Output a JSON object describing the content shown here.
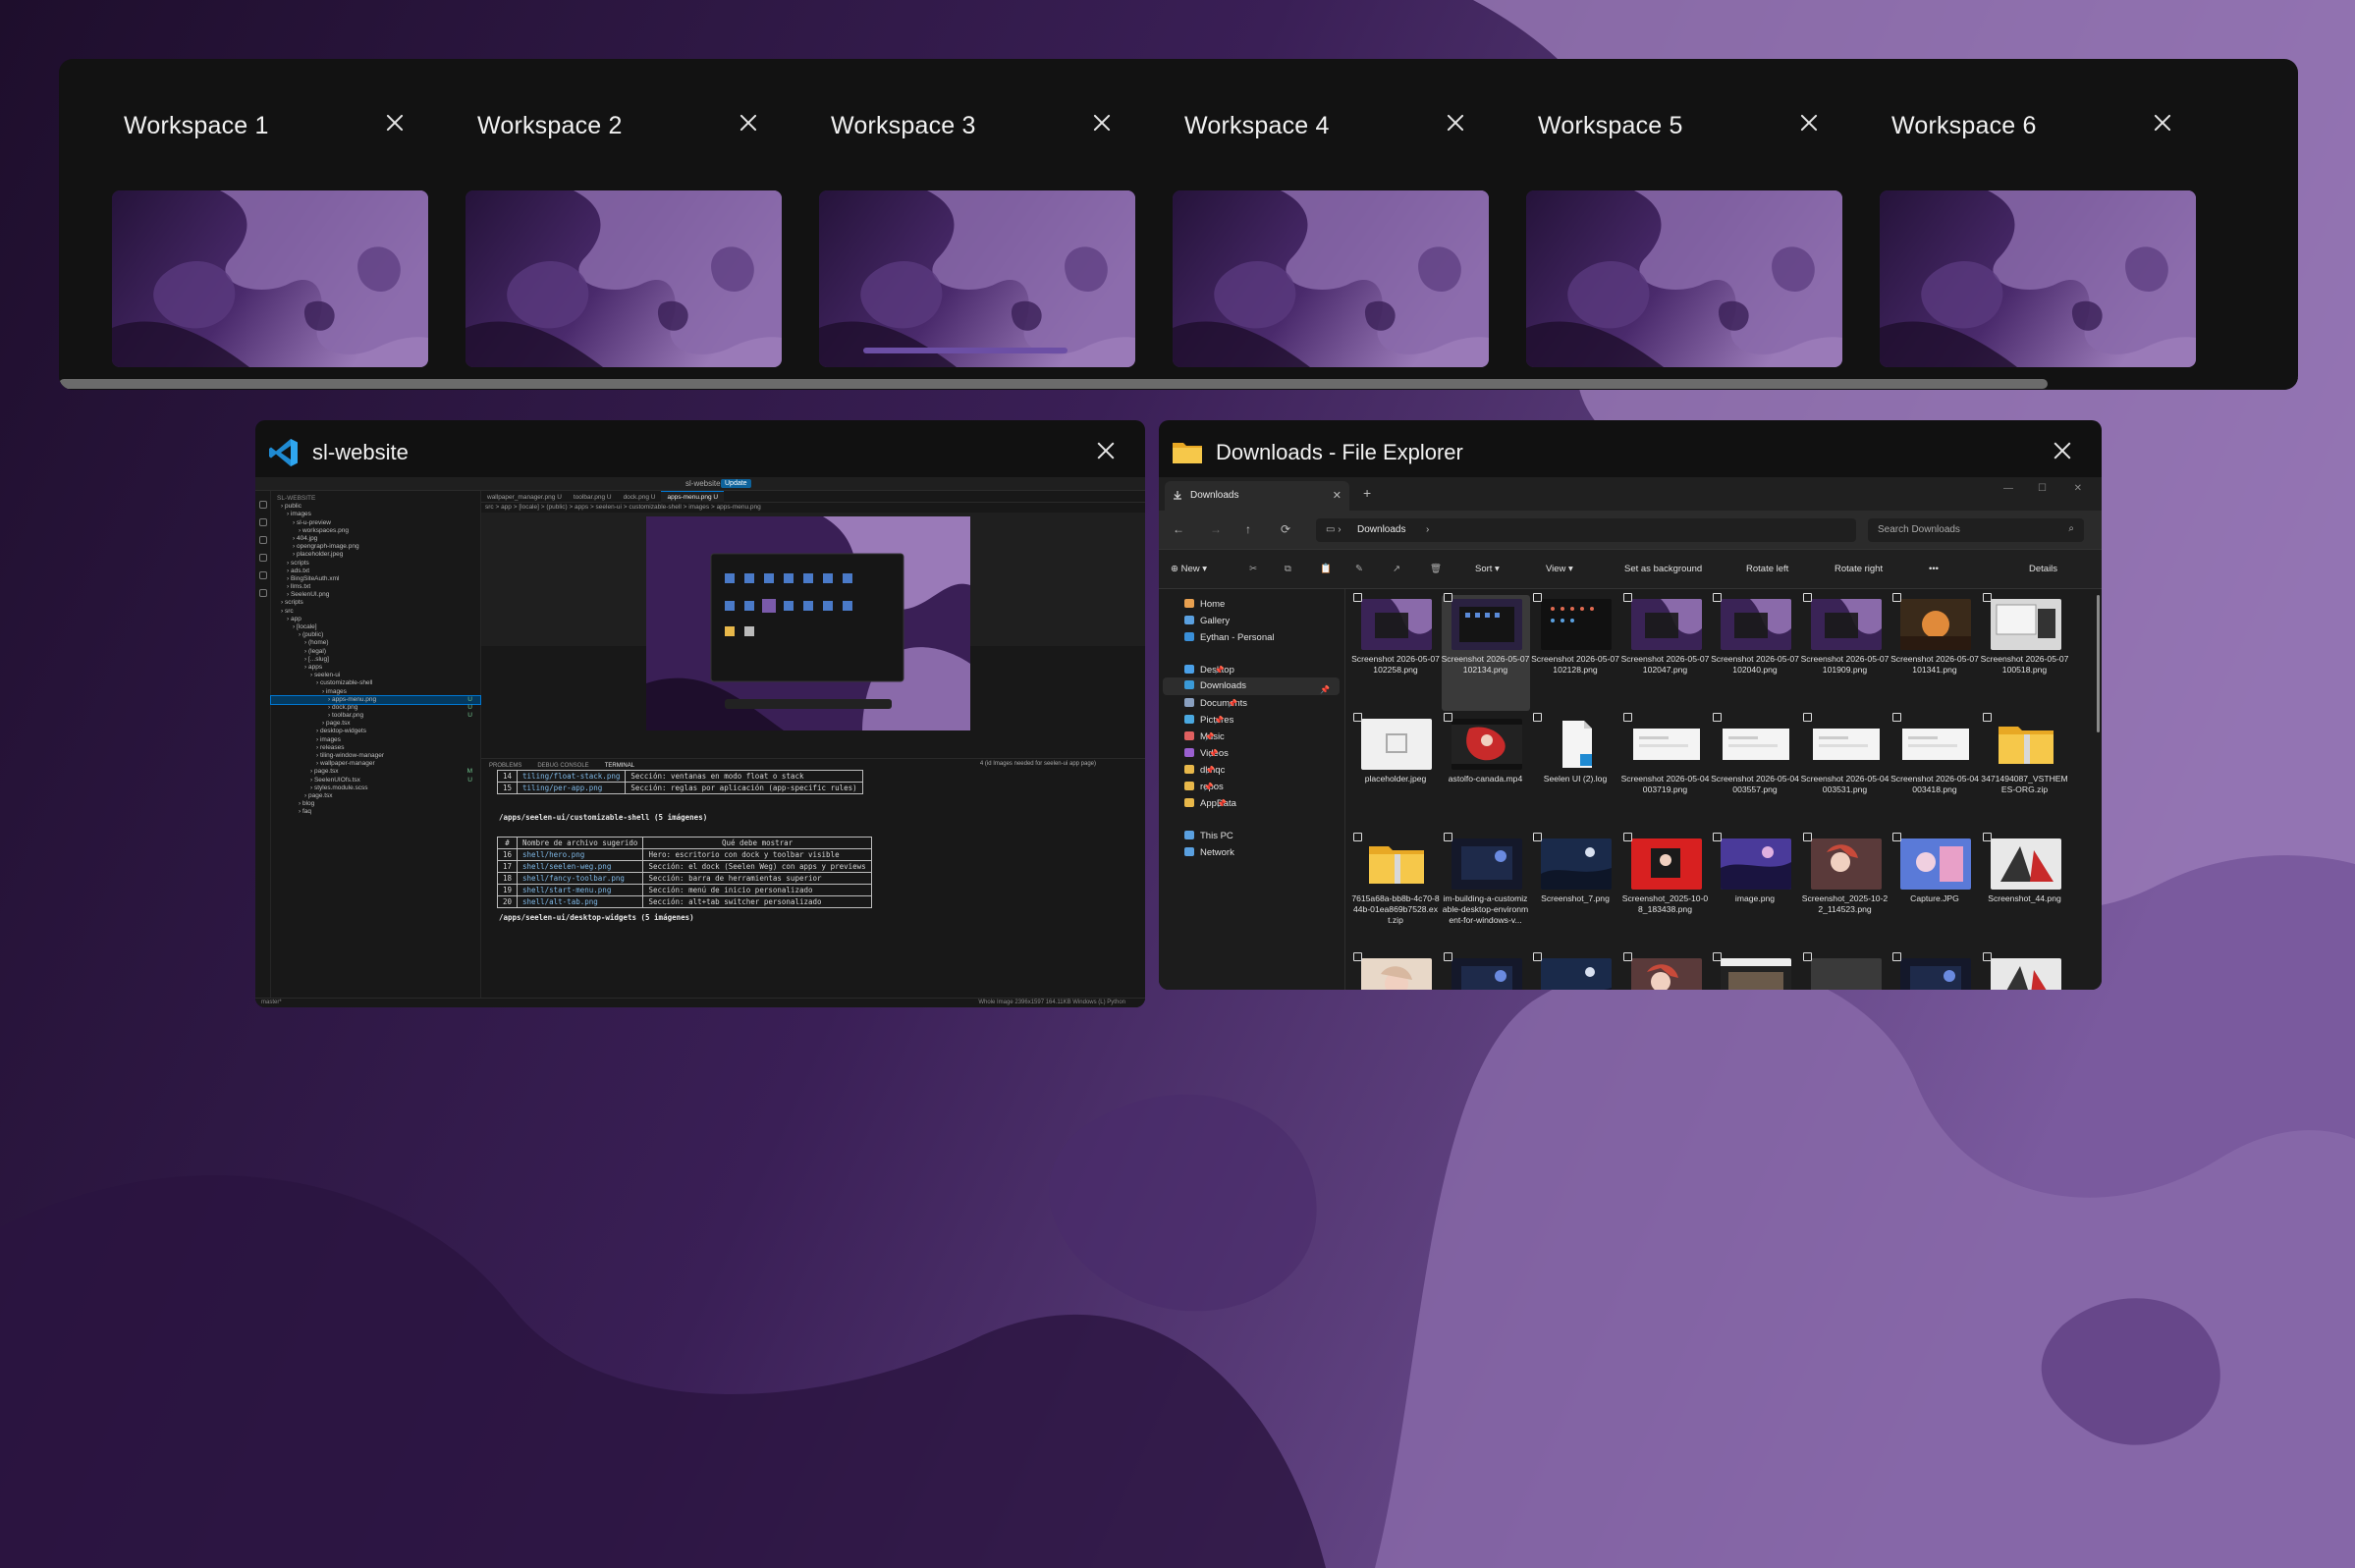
{
  "workspaces": [
    {
      "title": "Workspace 1"
    },
    {
      "title": "Workspace 2"
    },
    {
      "title": "Workspace 3"
    },
    {
      "title": "Workspace 4"
    },
    {
      "title": "Workspace 5"
    },
    {
      "title": "Workspace 6"
    }
  ],
  "active_workspace": "Workspace 3",
  "colors": {
    "wallpaper_dark": "#2a1538",
    "wallpaper_mid": "#5a3a7e",
    "wallpaper_light": "#9a7ab8",
    "active_indicator": "#6c4fa5"
  },
  "vscode": {
    "title": "sl-website",
    "icon": "vscode-icon",
    "titlebar_center": "sl-website",
    "update_label": "Update",
    "tabs": [
      "wallpaper_manager.png U",
      "toolbar.png U",
      "dock.png U",
      "apps-menu.png U"
    ],
    "breadcrumb": "src > app > [locale] > (public) > apps > seelen-ui > customizable-shell > images > apps-menu.png",
    "explorer_title": "SL-WEBSITE",
    "tree": [
      {
        "label": "public",
        "indent": 1,
        "badge": ""
      },
      {
        "label": "images",
        "indent": 2,
        "badge": ""
      },
      {
        "label": "sl-u-preview",
        "indent": 3,
        "badge": ""
      },
      {
        "label": "workspaces.png",
        "indent": 4,
        "badge": ""
      },
      {
        "label": "404.jpg",
        "indent": 3,
        "badge": ""
      },
      {
        "label": "opengraph-image.png",
        "indent": 3,
        "badge": ""
      },
      {
        "label": "placeholder.jpeg",
        "indent": 3,
        "badge": ""
      },
      {
        "label": "scripts",
        "indent": 2,
        "badge": ""
      },
      {
        "label": "ads.txt",
        "indent": 2,
        "badge": ""
      },
      {
        "label": "BingSiteAuth.xml",
        "indent": 2,
        "badge": ""
      },
      {
        "label": "llms.txt",
        "indent": 2,
        "badge": ""
      },
      {
        "label": "SeelenUI.png",
        "indent": 2,
        "badge": ""
      },
      {
        "label": "scripts",
        "indent": 1,
        "badge": ""
      },
      {
        "label": "src",
        "indent": 1,
        "badge": ""
      },
      {
        "label": "app",
        "indent": 2,
        "badge": ""
      },
      {
        "label": "[locale]",
        "indent": 3,
        "badge": ""
      },
      {
        "label": "(public)",
        "indent": 4,
        "badge": ""
      },
      {
        "label": "(home)",
        "indent": 5,
        "badge": ""
      },
      {
        "label": "(legal)",
        "indent": 5,
        "badge": ""
      },
      {
        "label": "[...slug]",
        "indent": 5,
        "badge": ""
      },
      {
        "label": "apps",
        "indent": 5,
        "badge": ""
      },
      {
        "label": "seelen-ui",
        "indent": 6,
        "badge": ""
      },
      {
        "label": "customizable-shell",
        "indent": 7,
        "badge": ""
      },
      {
        "label": "images",
        "indent": 8,
        "badge": ""
      },
      {
        "label": "apps-menu.png",
        "indent": 9,
        "badge": "U",
        "selected": true
      },
      {
        "label": "dock.png",
        "indent": 9,
        "badge": "U"
      },
      {
        "label": "toolbar.png",
        "indent": 9,
        "badge": "U"
      },
      {
        "label": "page.tsx",
        "indent": 8,
        "badge": ""
      },
      {
        "label": "desktop-widgets",
        "indent": 7,
        "badge": ""
      },
      {
        "label": "images",
        "indent": 7,
        "badge": ""
      },
      {
        "label": "releases",
        "indent": 7,
        "badge": ""
      },
      {
        "label": "tiling-window-manager",
        "indent": 7,
        "badge": ""
      },
      {
        "label": "wallpaper-manager",
        "indent": 7,
        "badge": ""
      },
      {
        "label": "page.tsx",
        "indent": 6,
        "badge": "M"
      },
      {
        "label": "SeelenUIOfs.tsx",
        "indent": 6,
        "badge": "U"
      },
      {
        "label": "styles.module.scss",
        "indent": 6,
        "badge": ""
      },
      {
        "label": "page.tsx",
        "indent": 5,
        "badge": ""
      },
      {
        "label": "blog",
        "indent": 4,
        "badge": ""
      },
      {
        "label": "faq",
        "indent": 4,
        "badge": ""
      }
    ],
    "panel_tabs": [
      "PROBLEMS",
      "DEBUG CONSOLE",
      "TERMINAL"
    ],
    "panel_note": "4 (id Images needed for seelen-ui app page)",
    "table1": [
      {
        "n": "14",
        "file": "tiling/float-stack.png",
        "desc": "Sección: ventanas en modo float o stack"
      },
      {
        "n": "15",
        "file": "tiling/per-app.png",
        "desc": "Sección: reglas por aplicación (app-specific rules)"
      }
    ],
    "heading1": "/apps/seelen-ui/customizable-shell (5 imágenes)",
    "table2_head": {
      "n": "#",
      "file": "Nombre de archivo sugerido",
      "desc": "Qué debe mostrar"
    },
    "table2": [
      {
        "n": "16",
        "file": "shell/hero.png",
        "desc": "Hero: escritorio con dock y toolbar visible"
      },
      {
        "n": "17",
        "file": "shell/seelen-weg.png",
        "desc": "Sección: el dock (Seelen Weg) con apps y previews"
      },
      {
        "n": "18",
        "file": "shell/fancy-toolbar.png",
        "desc": "Sección: barra de herramientas superior"
      },
      {
        "n": "19",
        "file": "shell/start-menu.png",
        "desc": "Sección: menú de inicio personalizado"
      },
      {
        "n": "20",
        "file": "shell/alt-tab.png",
        "desc": "Sección: alt+tab switcher personalizado"
      }
    ],
    "heading2": "/apps/seelen-ui/desktop-widgets (5 imágenes)",
    "status_left": "master*",
    "status_right": "Whole Image   2396x1597   164.11KB   Windows (L)   Python"
  },
  "explorer": {
    "title": "Downloads - File Explorer",
    "icon": "folder-icon",
    "tab_label": "Downloads",
    "new_tab": "+",
    "path_label": "Downloads",
    "search_placeholder": "Search Downloads",
    "commands": [
      "New",
      "Sort",
      "View",
      "Set as background",
      "Rotate left",
      "Rotate right",
      "•••",
      "Details"
    ],
    "sidebar": [
      {
        "label": "Home",
        "color": "#e8a050"
      },
      {
        "label": "Gallery",
        "color": "#5aa0e0"
      },
      {
        "label": "Eythan - Personal",
        "color": "#3a8fd8"
      },
      {
        "label": "Desktop",
        "color": "#4aa0e8",
        "pin": true
      },
      {
        "label": "Downloads",
        "color": "#3a9ad8",
        "pin": true,
        "selected": true
      },
      {
        "label": "Documents",
        "color": "#8aa0c0",
        "pin": true
      },
      {
        "label": "Pictures",
        "color": "#4aa8e0",
        "pin": true
      },
      {
        "label": "Music",
        "color": "#e06060",
        "pin": true
      },
      {
        "label": "Videos",
        "color": "#9a60d0",
        "pin": true
      },
      {
        "label": "dlmqc",
        "color": "#e8b84a",
        "pin": true
      },
      {
        "label": "repos",
        "color": "#e8b84a",
        "pin": true
      },
      {
        "label": "AppData",
        "color": "#e8b84a",
        "pin": true
      },
      {
        "label": "This PC",
        "color": "#5aa0e0"
      },
      {
        "label": "Network",
        "color": "#5aa0e0"
      }
    ],
    "files": [
      {
        "name": "Screenshot 2026-05-07 102258.png",
        "thumb": "purple"
      },
      {
        "name": "Screenshot 2026-05-07 102134.png",
        "thumb": "dark",
        "selected": true
      },
      {
        "name": "Screenshot 2026-05-07 102128.png",
        "thumb": "darkdots"
      },
      {
        "name": "Screenshot 2026-05-07 102047.png",
        "thumb": "purple"
      },
      {
        "name": "Screenshot 2026-05-07 102040.png",
        "thumb": "purple"
      },
      {
        "name": "Screenshot 2026-05-07 101909.png",
        "thumb": "purple"
      },
      {
        "name": "Screenshot 2026-05-07 101341.png",
        "thumb": "orange"
      },
      {
        "name": "Screenshot 2026-05-07 100518.png",
        "thumb": "light"
      },
      {
        "name": "placeholder.jpeg",
        "thumb": "placeholder"
      },
      {
        "name": "astolfo-canada.mp4",
        "thumb": "video"
      },
      {
        "name": "Seelen UI (2).log",
        "thumb": "doc"
      },
      {
        "name": "Screenshot 2026-05-04 003719.png",
        "thumb": "white"
      },
      {
        "name": "Screenshot 2026-05-04 003557.png",
        "thumb": "white"
      },
      {
        "name": "Screenshot 2026-05-04 003531.png",
        "thumb": "white"
      },
      {
        "name": "Screenshot 2026-05-04 003418.png",
        "thumb": "white"
      },
      {
        "name": "3471494087_VSTHEMES-ORG.zip",
        "thumb": "zip"
      },
      {
        "name": "7615a68a-bb8b-4c70-844b-01ea869b7528.ext.zip",
        "thumb": "zip"
      },
      {
        "name": "im-building-a-customizable-desktop-environment-for-windows-v...",
        "thumb": "darkblue"
      },
      {
        "name": "Screenshot_7.png",
        "thumb": "night"
      },
      {
        "name": "Screenshot_2025-10-08_183438.png",
        "thumb": "red"
      },
      {
        "name": "image.png",
        "thumb": "violet"
      },
      {
        "name": "Screenshot_2025-10-22_114523.png",
        "thumb": "anime"
      },
      {
        "name": "Capture.JPG",
        "thumb": "blue"
      },
      {
        "name": "Screenshot_44.png",
        "thumb": "bw"
      },
      {
        "name": "",
        "thumb": "anime2"
      },
      {
        "name": "",
        "thumb": "darkblue"
      },
      {
        "name": "",
        "thumb": "night"
      },
      {
        "name": "",
        "thumb": "anime"
      },
      {
        "name": "",
        "thumb": "film"
      },
      {
        "name": "",
        "thumb": "grey"
      },
      {
        "name": "",
        "thumb": "darkblue"
      },
      {
        "name": "",
        "thumb": "bw"
      }
    ]
  }
}
